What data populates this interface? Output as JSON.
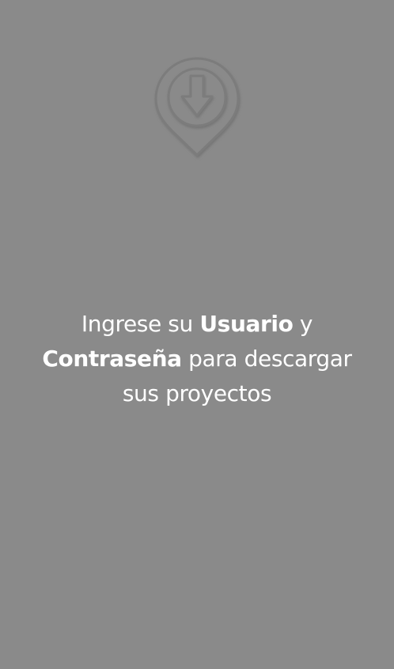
{
  "background_color": "#8a8a8a",
  "icon": {
    "name": "download-pin-icon"
  },
  "message": {
    "part1": "Ingrese su ",
    "bold1": "Usuario",
    "part2": " y",
    "bold2": "Contraseña",
    "part3": " para descargar",
    "line3": "sus proyectos"
  }
}
